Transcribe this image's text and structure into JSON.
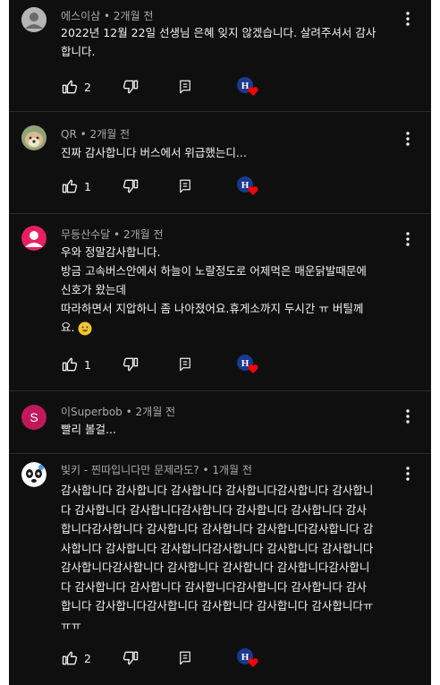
{
  "comments": [
    {
      "author": "에스이삼",
      "time": "2개월 전",
      "lines": [
        "2022년 12월 22일 선생님 은혜 잊지 않겠습니다. 살려주셔서 감사",
        "합니다."
      ],
      "likes": "2",
      "avatar_icon": "person-icon",
      "avatar_color": "#cfcfcf"
    },
    {
      "author": "QR",
      "time": "2개월 전",
      "lines": [
        "진짜 감사합니다 버스에서 위급했는디..."
      ],
      "likes": "1",
      "avatar_icon": "dog-photo-avatar",
      "avatar_color": "#b39b7a"
    },
    {
      "author": "무등산수달",
      "time": "2개월 전",
      "lines": [
        "우와 정말감사합니다.",
        "방금 고속버스안에서 하늘이 노랄정도로  어제먹은 매운닭발때문에",
        "신호가 왔는데",
        "따라하면서 지압하니 좀 나아졌어요.휴게소까지 두시간 ㅠ 버틸께",
        "요."
      ],
      "likes": "1",
      "avatar_icon": "person-icon",
      "avatar_color": "#e91e63"
    },
    {
      "author": "이Superbob",
      "time": "2개월 전",
      "lines": [
        "빨리 볼걸..."
      ],
      "avatar_letter": "S",
      "avatar_color": "#c2185b"
    },
    {
      "author": "빛키 - 찐따입니다만 문제라도?",
      "time": "1개월 전",
      "lines": [
        "감사합니다 감사합니다 감사합니다 감사합니다감사합니다 감사합니",
        "다 감사합니다 감사합니다감사합니다 감사합니다 감사합니다 감사",
        "합니다감사합니다 감사합니다 감사합니다 감사합니다감사합니다 감",
        "사합니다 감사합니다 감사합니다감사합니다 감사합니다 감사합니다",
        "감사합니다감사합니다 감사합니다 감사합니다 감사합니다감사합니",
        "다 감사합니다 감사합니다 감사합니다감사합니다 감사합니다 감사",
        "합니다 감사합니다감사합니다 감사합니다 감사합니다 감사합니다ㅠ",
        "ㅠㅠ"
      ],
      "likes": "2",
      "avatar_icon": "panda-face-avatar",
      "avatar_color": "#ffffff"
    }
  ],
  "icons": {
    "like": "thumbs-up-icon",
    "dislike": "thumbs-down-icon",
    "reply": "reply-icon",
    "more": "more-vertical-icon",
    "creator_heart": "creator-heart-icon"
  },
  "colors": {
    "background": "#0f0f0f",
    "text": "#f1f1f1",
    "meta": "#aaaaaa",
    "heart": "#ff0000",
    "creator_badge": "#1a3a8f"
  }
}
